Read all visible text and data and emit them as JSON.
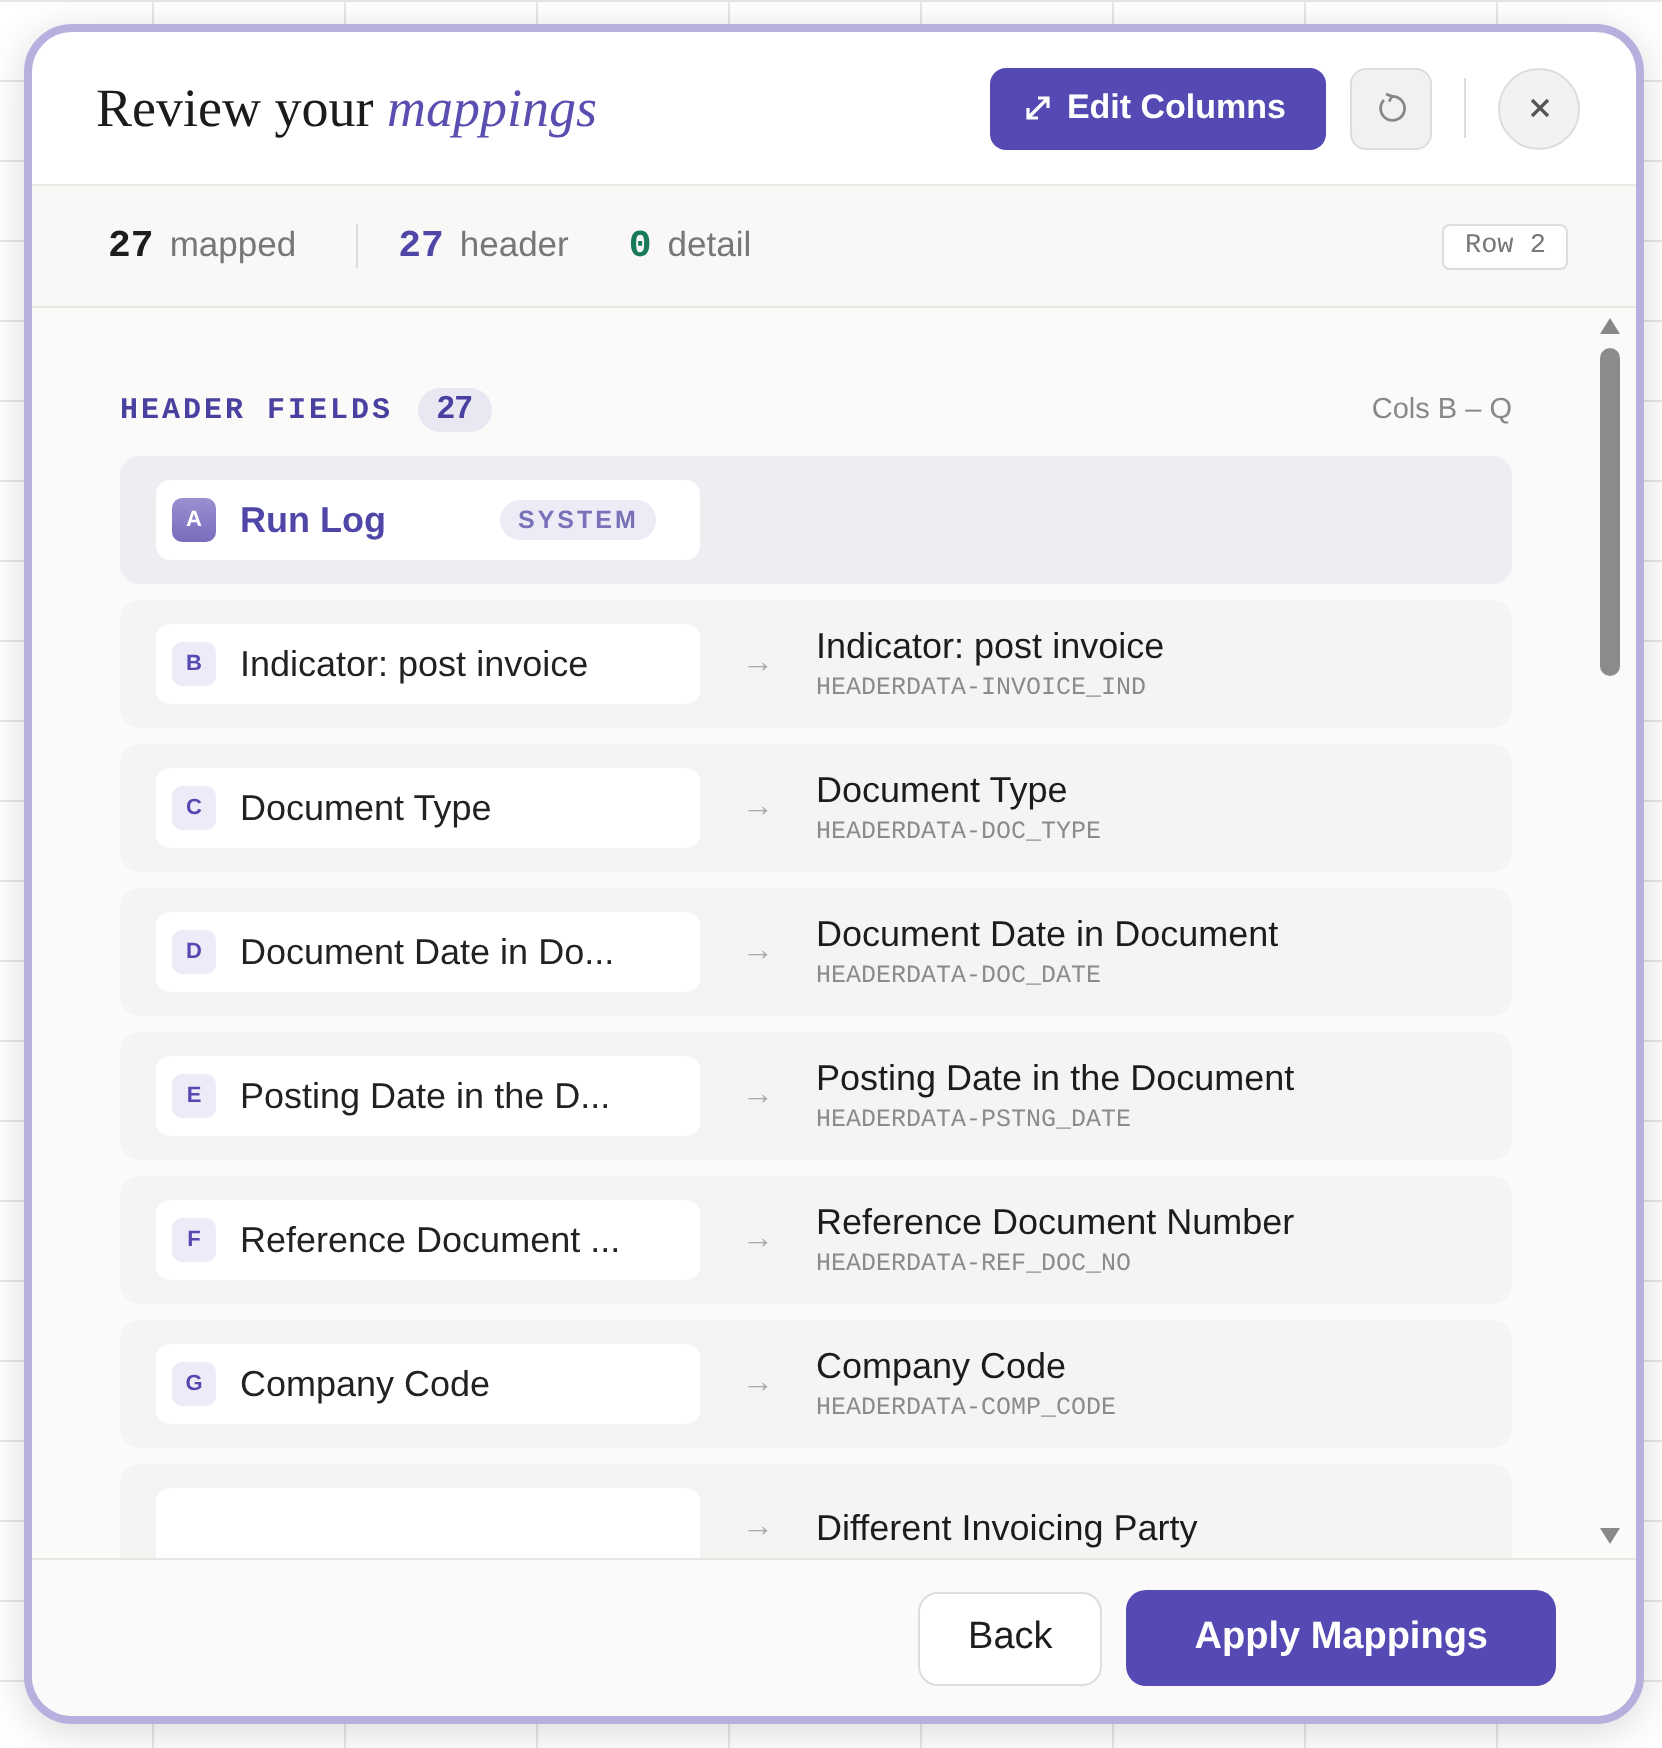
{
  "dialog": {
    "title": "Review your",
    "title_accent": "mappings",
    "edit_button": "Edit Columns",
    "buttons": [
      "Back",
      "Apply Mappings"
    ]
  },
  "stats": [
    {
      "count": "27",
      "label": "mapped",
      "kind": "total"
    },
    {
      "count": "27",
      "label": "header",
      "kind": "header"
    },
    {
      "count": "0",
      "label": "detail",
      "kind": "detail"
    }
  ],
  "row_badge": "Row 2",
  "section": {
    "title": "HEADER FIELDS",
    "count": "27",
    "range": "Cols B – Q"
  },
  "rows": [
    {
      "letter": "A",
      "source": "Run Log",
      "kind": "system",
      "tag": "SYSTEM"
    },
    {
      "letter": "B",
      "source": "Indicator: post invoice",
      "kind": "mapped",
      "arrow": "→",
      "target": "Indicator: post invoice",
      "code": "HEADERDATA-INVOICE_IND"
    },
    {
      "letter": "C",
      "source": "Document Type",
      "kind": "mapped",
      "arrow": "→",
      "target": "Document Type",
      "code": "HEADERDATA-DOC_TYPE"
    },
    {
      "letter": "D",
      "source": "Document Date in Do...",
      "kind": "mapped",
      "arrow": "→",
      "target": "Document Date in Document",
      "code": "HEADERDATA-DOC_DATE"
    },
    {
      "letter": "E",
      "source": "Posting Date in the D...",
      "kind": "mapped",
      "arrow": "→",
      "target": "Posting Date in the Document",
      "code": "HEADERDATA-PSTNG_DATE"
    },
    {
      "letter": "F",
      "source": "Reference Document ...",
      "kind": "mapped",
      "arrow": "→",
      "target": "Reference Document Number",
      "code": "HEADERDATA-REF_DOC_NO"
    },
    {
      "letter": "G",
      "source": "Company Code",
      "kind": "mapped",
      "arrow": "→",
      "target": "Company Code",
      "code": "HEADERDATA-COMP_CODE"
    },
    {
      "kind": "mapped",
      "arrow": "→",
      "target": "Different Invoicing Party"
    }
  ]
}
